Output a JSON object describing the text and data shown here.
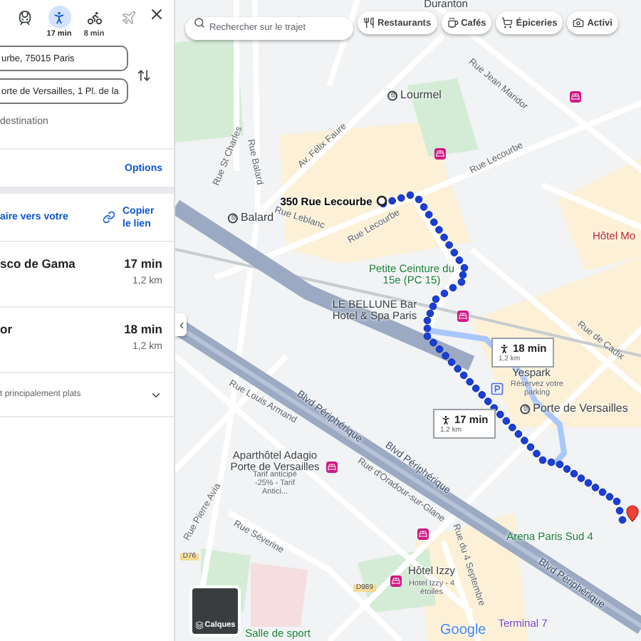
{
  "panel": {
    "modes": [
      {
        "kind": "transit",
        "selected": false,
        "disabled": false
      },
      {
        "kind": "walk",
        "selected": true,
        "disabled": false,
        "time": "17 min"
      },
      {
        "kind": "bike",
        "selected": false,
        "disabled": false,
        "time": "8 min"
      },
      {
        "kind": "flight",
        "selected": false,
        "disabled": true
      }
    ],
    "origin": "urbe, 75015 Paris",
    "destination": "orte de Versailles, 1 Pl. de la",
    "add_destination": "destination",
    "options": "Options",
    "share_link": "aire vers votre",
    "copy_link": "Copier le lien",
    "routes": [
      {
        "name": "sco de Gama",
        "duration": "17 min",
        "distance": "1,2 km"
      },
      {
        "name": "or",
        "duration": "18 min",
        "distance": "1,2 km"
      }
    ],
    "note": "t principalement plats"
  },
  "map": {
    "search": {
      "placeholder": "Rechercher sur le trajet"
    },
    "chips": [
      {
        "kind": "restaurants",
        "label": "Restaurants"
      },
      {
        "kind": "cafes",
        "label": "Cafés"
      },
      {
        "kind": "groceries",
        "label": "Épiceries"
      },
      {
        "kind": "activities",
        "label": "Activi"
      }
    ],
    "labels": [
      {
        "text": "Duranton",
        "kind": "place"
      },
      {
        "text": "Rue Jean Maridor",
        "kind": "street"
      },
      {
        "text": "Lourmel",
        "kind": "metro"
      },
      {
        "text": "Rue Lecourbe",
        "kind": "street"
      },
      {
        "text": "Av. Félix Faure",
        "kind": "street"
      },
      {
        "text": "Rue St Charles",
        "kind": "street"
      },
      {
        "text": "Rue Balard",
        "kind": "street"
      },
      {
        "text": "350 Rue Lecourbe",
        "kind": "address"
      },
      {
        "text": "Balard",
        "kind": "metro"
      },
      {
        "text": "Rue Leblanc",
        "kind": "street"
      },
      {
        "text": "Rue Lecourbe",
        "kind": "street"
      },
      {
        "text": "Petite Ceinture du 15e (PC 15)",
        "kind": "park"
      },
      {
        "text": "LE BELLUNE Bar Hotel & Spa Paris",
        "kind": "place"
      },
      {
        "text": "Hôtel Mo",
        "kind": "hotel"
      },
      {
        "text": "Rue de Cadix",
        "kind": "street"
      },
      {
        "text": "Yespark",
        "kind": "place"
      },
      {
        "text": "Réservez votre parking",
        "kind": "note"
      },
      {
        "text": "Porte de Versailles",
        "kind": "metro"
      },
      {
        "text": "Rue Louis Armand",
        "kind": "street"
      },
      {
        "text": "Blvd Périphérique",
        "kind": "road"
      },
      {
        "text": "Blvd Périphérique",
        "kind": "road"
      },
      {
        "text": "Rue d'Oradour-sur-Glane",
        "kind": "street"
      },
      {
        "text": "Aparthôtel Adagio Porte de Versailles",
        "kind": "place"
      },
      {
        "text": "Tarif anticipé -25% - Tarif Antici...",
        "kind": "note"
      },
      {
        "text": "Rue Pierre Avia",
        "kind": "street"
      },
      {
        "text": "Rue Séverine",
        "kind": "street"
      },
      {
        "text": "Arena Paris Sud 4",
        "kind": "park"
      },
      {
        "text": "Hôtel Izzy",
        "kind": "place"
      },
      {
        "text": "Hotel Izzy - 4 étoiles",
        "kind": "note"
      },
      {
        "text": "Rue du 4 Septembre",
        "kind": "street"
      },
      {
        "text": "Blvd Périphérique",
        "kind": "road"
      },
      {
        "text": "D76",
        "kind": "shield"
      },
      {
        "text": "D989",
        "kind": "shield"
      },
      {
        "text": "Terminal 7",
        "kind": "venue"
      },
      {
        "text": "Salle de sport",
        "kind": "park"
      }
    ],
    "route_badges": [
      {
        "duration": "18 min",
        "distance": "1,2 km"
      },
      {
        "duration": "17 min",
        "distance": "1,2 km"
      }
    ],
    "layers_label": "Calques",
    "logo": "Google"
  }
}
